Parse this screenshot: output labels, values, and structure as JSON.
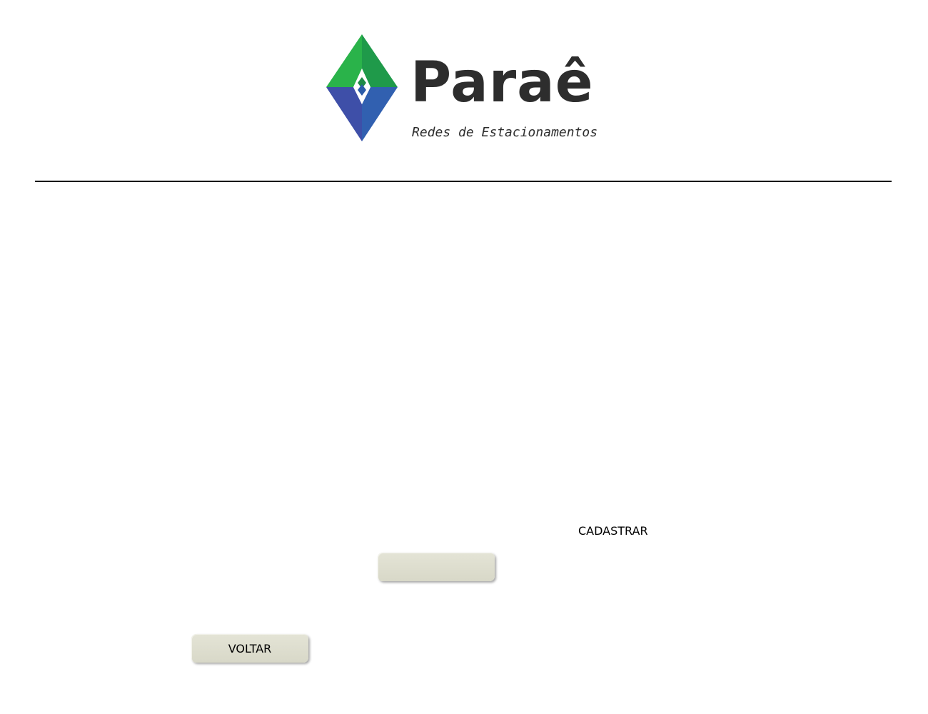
{
  "logo": {
    "name": "Paraê",
    "tagline": "Redes de Estacionamentos",
    "icon": "diamond-logo-icon",
    "colors": {
      "green_light": "#2ab34a",
      "green_dark": "#1f8a47",
      "blue_light": "#3553a8",
      "blue_dark": "#2c3f91",
      "text": "#2d2d2d"
    }
  },
  "actions": {
    "cadastrar_label": "CADASTRAR",
    "blank_button_label": "",
    "voltar_label": "VOLTAR"
  },
  "colors": {
    "background": "#ffffff",
    "divider": "#000000",
    "button_bg": "#dcdccc"
  }
}
